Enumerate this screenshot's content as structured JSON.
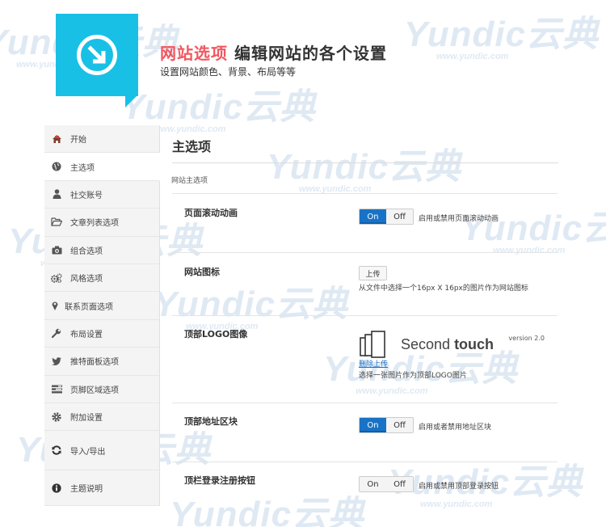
{
  "watermark": {
    "brand": "Yundic云典",
    "url": "www.yundic.com"
  },
  "header": {
    "title_accent": "网站选项",
    "title_rest": " 编辑网站的各个设置",
    "subtitle": "设置网站颜色、背景、布局等等",
    "logo_icon": "arrow-down-right-circle-icon",
    "accent_color": "#19c0e6",
    "title_accent_color": "#f2575f"
  },
  "sidebar": {
    "items": [
      {
        "label": "开始",
        "icon": "home-icon"
      },
      {
        "label": "主选项",
        "icon": "globe-icon"
      },
      {
        "label": "社交账号",
        "icon": "user-icon"
      },
      {
        "label": "文章列表选项",
        "icon": "folder-open-icon"
      },
      {
        "label": "组合选项",
        "icon": "camera-icon"
      },
      {
        "label": "风格选项",
        "icon": "cogs-icon"
      },
      {
        "label": "联系页面选项",
        "icon": "map-marker-icon"
      },
      {
        "label": "布局设置",
        "icon": "wrench-icon"
      },
      {
        "label": "推特面板选项",
        "icon": "twitter-icon"
      },
      {
        "label": "页脚区域选项",
        "icon": "tasks-icon"
      },
      {
        "label": "附加设置",
        "icon": "gear-icon"
      },
      {
        "label": "导入/导出",
        "icon": "refresh-icon"
      },
      {
        "label": "主题说明",
        "icon": "info-icon"
      }
    ],
    "active_index": 1
  },
  "main": {
    "title": "主选项",
    "section_label": "网站主选项",
    "rows": {
      "scroll_anim": {
        "label": "页面滚动动画",
        "on": "On",
        "off": "Off",
        "hint": "启用或禁用页面滚动动画"
      },
      "favicon": {
        "label": "网站图标",
        "button": "上传",
        "hint": "从文件中选择一个16px X 16px的图片作为网站图标"
      },
      "top_logo": {
        "label": "顶部LOGO图像",
        "preview_text_light": "Second ",
        "preview_text_bold": "touch",
        "preview_version": "version 2.0",
        "link": "删除上传",
        "hint": "选择一张图片作为顶部LOGO图片"
      },
      "top_address": {
        "label": "顶部地址区块",
        "on": "On",
        "off": "Off",
        "hint": "启用或者禁用地址区块"
      },
      "top_login": {
        "label": "顶栏登录注册按钮",
        "on": "On",
        "off": "Off",
        "hint": "启用或禁用顶部登录按钮"
      }
    }
  }
}
